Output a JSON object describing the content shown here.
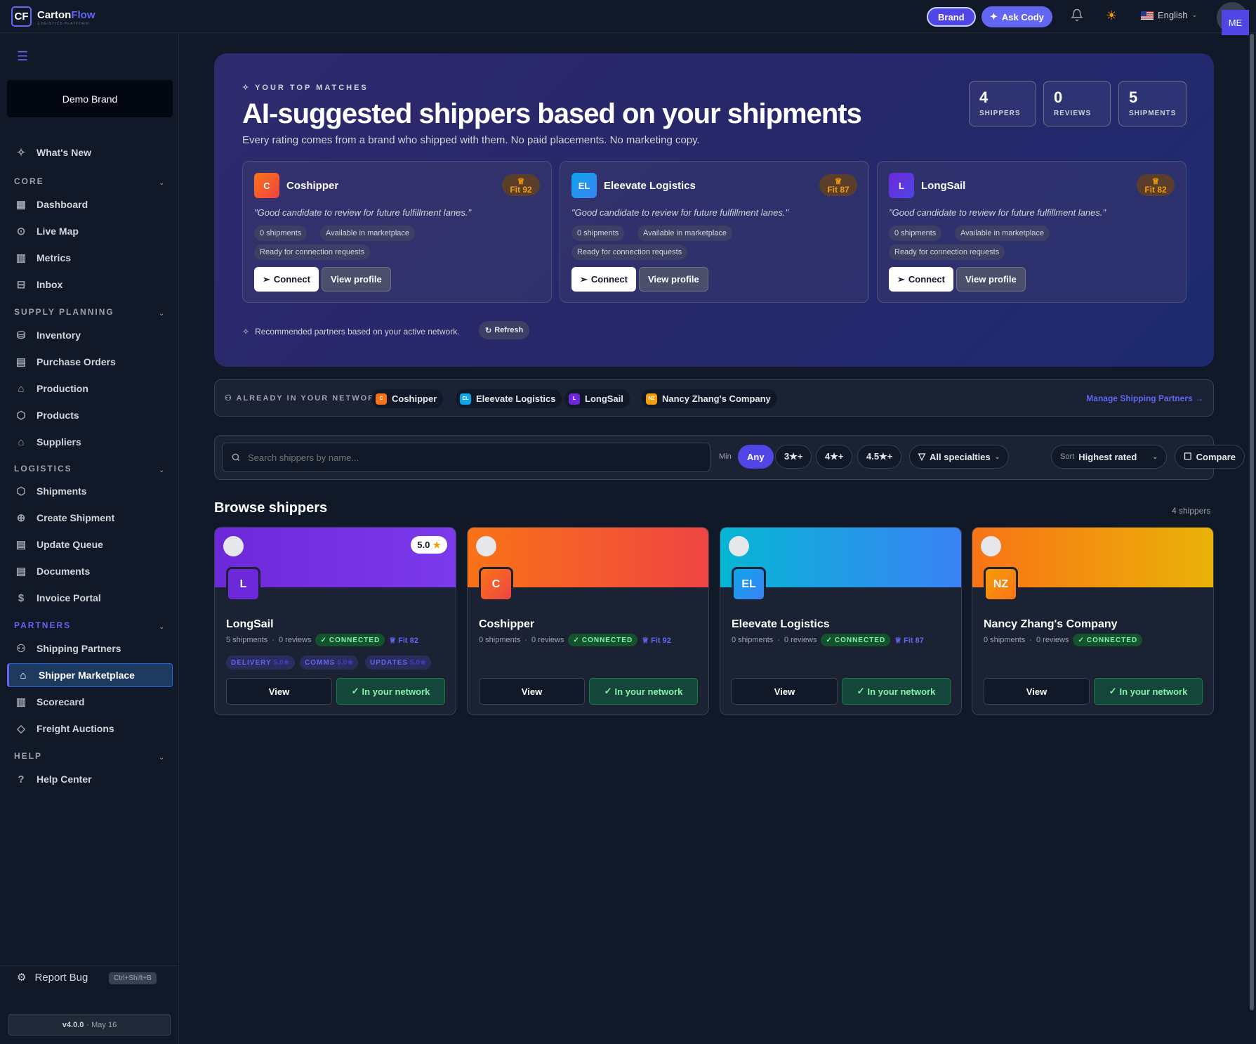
{
  "app": {
    "logo_mark": "CF",
    "logo_name_a": "Carton",
    "logo_name_b": "Flow",
    "logo_tagline": "LOGISTICS PLATFORM",
    "accent": "#6366f1"
  },
  "topbar": {
    "brand_pill": "Brand",
    "ask_cody": "Ask Cody",
    "language": "English",
    "avatar": "ME",
    "icons": [
      "bell-icon",
      "sun-icon",
      "us-flag-icon"
    ]
  },
  "sidebar": {
    "brand_name": "Demo Brand",
    "whats_new": "What's New",
    "sections": [
      {
        "label": "CORE",
        "items": [
          "Dashboard",
          "Live Map",
          "Metrics",
          "Inbox"
        ]
      },
      {
        "label": "SUPPLY PLANNING",
        "items": [
          "Inventory",
          "Purchase Orders",
          "Production",
          "Products",
          "Suppliers"
        ]
      },
      {
        "label": "LOGISTICS",
        "items": [
          "Shipments",
          "Create Shipment",
          "Update Queue",
          "Documents",
          "Invoice Portal"
        ]
      },
      {
        "label": "PARTNERS",
        "items": [
          "Shipping Partners",
          "Shipper Marketplace",
          "Scorecard",
          "Freight Auctions"
        ]
      },
      {
        "label": "HELP",
        "items": [
          "Help Center"
        ]
      }
    ],
    "active_item": "Shipper Marketplace",
    "report_bug": "Report Bug",
    "report_shortcut": "Ctrl+Shift+B",
    "version": "v4.0.0",
    "version_date": "· May 16"
  },
  "hero": {
    "eyebrow": "YOUR TOP MATCHES",
    "title": "AI-suggested shippers based on your shipments",
    "subtitle": "Every rating comes from a brand who shipped with them. No paid placements. No marketing copy.",
    "stats": [
      {
        "value": "4",
        "label": "SHIPPERS"
      },
      {
        "value": "0",
        "label": "REVIEWS"
      },
      {
        "value": "5",
        "label": "SHIPMENTS"
      }
    ],
    "matches": [
      {
        "initials": "C",
        "name": "Coshipper",
        "fit": "Fit 92",
        "quote": "\"Good candidate to review for future fulfillment lanes.\"",
        "chips": [
          "0 shipments",
          "Available in marketplace",
          "Ready for connection requests"
        ],
        "color": "#f97316"
      },
      {
        "initials": "EL",
        "name": "Eleevate Logistics",
        "fit": "Fit 87",
        "quote": "\"Good candidate to review for future fulfillment lanes.\"",
        "chips": [
          "0 shipments",
          "Available in marketplace",
          "Ready for connection requests"
        ],
        "color": "#0ea5e9"
      },
      {
        "initials": "L",
        "name": "LongSail",
        "fit": "Fit 82",
        "quote": "\"Good candidate to review for future fulfillment lanes.\"",
        "chips": [
          "0 shipments",
          "Available in marketplace",
          "Ready for connection requests"
        ],
        "color": "#6d28d9"
      }
    ],
    "connect_label": "Connect",
    "view_profile_label": "View profile",
    "rec_note": "Recommended partners based on your active network.",
    "refresh_label": "Refresh"
  },
  "network": {
    "label": "ALREADY IN YOUR NETWORK",
    "partners": [
      {
        "initials": "C",
        "name": "Coshipper",
        "color": "#f97316"
      },
      {
        "initials": "EL",
        "name": "Eleevate Logistics",
        "color": "#0ea5e9"
      },
      {
        "initials": "L",
        "name": "LongSail",
        "color": "#6d28d9"
      },
      {
        "initials": "NZ",
        "name": "Nancy Zhang's Company",
        "color": "#f59e0b"
      }
    ],
    "manage_link": "Manage Shipping Partners →"
  },
  "filters": {
    "search_placeholder": "Search shippers by name...",
    "min_label": "Min",
    "rating_options": [
      "Any",
      "3★+",
      "4★+",
      "4.5★+"
    ],
    "selected_rating": "Any",
    "specialties": "All specialties",
    "sort_label": "Sort",
    "sort_value": "Highest rated",
    "compare": "Compare"
  },
  "browse": {
    "title": "Browse shippers",
    "count": "4 shippers",
    "view_label": "View",
    "in_network_label": "In your network",
    "connected_label": "CONNECTED",
    "shippers": [
      {
        "initials": "L",
        "name": "LongSail",
        "shipments": "5 shipments",
        "reviews": "0 reviews",
        "fit": "Fit 82",
        "rating": "5.0",
        "sub_ratings": [
          {
            "label": "DELIVERY",
            "value": "5.0★"
          },
          {
            "label": "COMMS",
            "value": "5.0★"
          },
          {
            "label": "UPDATES",
            "value": "5.0★"
          }
        ],
        "banner": [
          "#6d28d9",
          "#7c3aed"
        ],
        "logo_color": "#6d28d9"
      },
      {
        "initials": "C",
        "name": "Coshipper",
        "shipments": "0 shipments",
        "reviews": "0 reviews",
        "fit": "Fit 92",
        "banner": [
          "#f97316",
          "#ef4444"
        ],
        "logo_color": "#f97316"
      },
      {
        "initials": "EL",
        "name": "Eleevate Logistics",
        "shipments": "0 shipments",
        "reviews": "0 reviews",
        "fit": "Fit 87",
        "banner": [
          "#06b6d4",
          "#3b82f6"
        ],
        "logo_color": "#0ea5e9"
      },
      {
        "initials": "NZ",
        "name": "Nancy Zhang's Company",
        "shipments": "0 shipments",
        "reviews": "0 reviews",
        "banner": [
          "#f97316",
          "#eab308"
        ],
        "logo_color": "#f59e0b"
      }
    ]
  }
}
